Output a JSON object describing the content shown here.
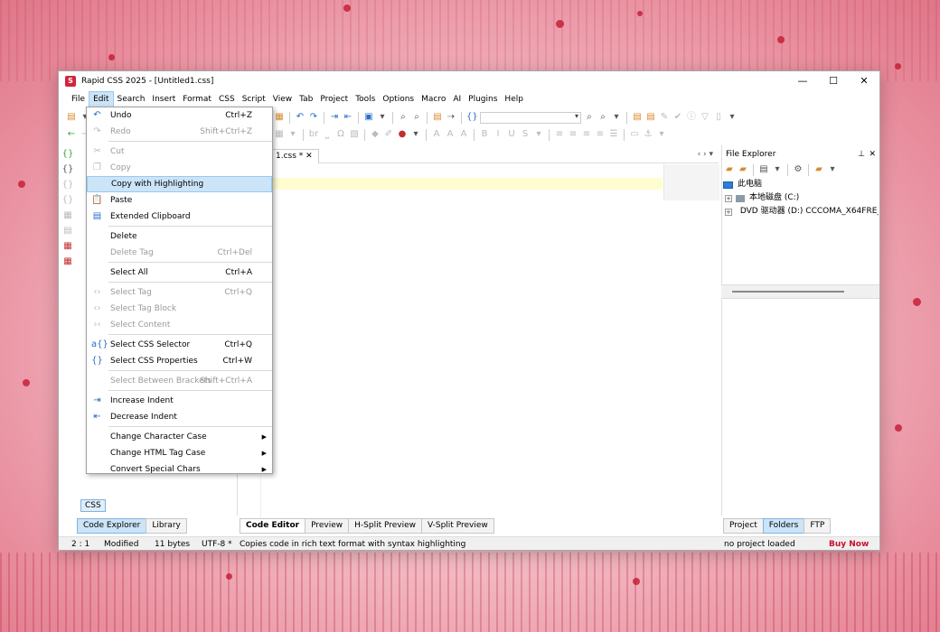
{
  "window": {
    "title": "Rapid CSS 2025 - [Untitled1.css]",
    "minimize": "—",
    "maximize": "☐",
    "close": "✕"
  },
  "menubar": [
    "File",
    "Edit",
    "Search",
    "Insert",
    "Format",
    "CSS",
    "Script",
    "View",
    "Tab",
    "Project",
    "Tools",
    "Options",
    "Macro",
    "AI",
    "Plugins",
    "Help"
  ],
  "menubar_active": "Edit",
  "document_tab": {
    "label": "1.css *",
    "close": "✕"
  },
  "tab_nav": "‹ › ▾",
  "edit_menu": [
    {
      "label": "Undo",
      "shortcut": "Ctrl+Z",
      "icon": "undo-icon",
      "glyph": "↶",
      "enabled": true
    },
    {
      "label": "Redo",
      "shortcut": "Shift+Ctrl+Z",
      "icon": "redo-icon",
      "glyph": "↷",
      "enabled": false
    },
    {
      "sep": true
    },
    {
      "label": "Cut",
      "shortcut": "",
      "icon": "scissors-icon",
      "glyph": "✂",
      "enabled": false
    },
    {
      "label": "Copy",
      "shortcut": "",
      "icon": "copy-icon",
      "glyph": "❐",
      "enabled": false
    },
    {
      "label": "Copy with Highlighting",
      "shortcut": "",
      "icon": "",
      "glyph": "",
      "enabled": true,
      "hover": true
    },
    {
      "label": "Paste",
      "shortcut": "",
      "icon": "paste-icon",
      "glyph": "📋",
      "enabled": true
    },
    {
      "label": "Extended Clipboard",
      "shortcut": "",
      "icon": "clipboard-icon",
      "glyph": "▤",
      "enabled": true
    },
    {
      "sep": true
    },
    {
      "label": "Delete",
      "shortcut": "",
      "icon": "",
      "glyph": "",
      "enabled": true
    },
    {
      "label": "Delete Tag",
      "shortcut": "Ctrl+Del",
      "icon": "",
      "glyph": "",
      "enabled": false
    },
    {
      "sep": true
    },
    {
      "label": "Select All",
      "shortcut": "Ctrl+A",
      "icon": "",
      "glyph": "",
      "enabled": true
    },
    {
      "sep": true
    },
    {
      "label": "Select Tag",
      "shortcut": "Ctrl+Q",
      "icon": "select-tag-icon",
      "glyph": "‹›",
      "enabled": false
    },
    {
      "label": "Select Tag Block",
      "shortcut": "",
      "icon": "select-tag-block-icon",
      "glyph": "‹›",
      "enabled": false
    },
    {
      "label": "Select Content",
      "shortcut": "",
      "icon": "select-content-icon",
      "glyph": "›‹",
      "enabled": false
    },
    {
      "sep": true
    },
    {
      "label": "Select CSS Selector",
      "shortcut": "Ctrl+Q",
      "icon": "css-selector-icon",
      "glyph": "a{}",
      "enabled": true
    },
    {
      "label": "Select CSS Properties",
      "shortcut": "Ctrl+W",
      "icon": "css-properties-icon",
      "glyph": "{}",
      "enabled": true
    },
    {
      "sep": true
    },
    {
      "label": "Select Between Brackets",
      "shortcut": "Shift+Ctrl+A",
      "icon": "",
      "glyph": "",
      "enabled": false
    },
    {
      "sep": true
    },
    {
      "label": "Increase Indent",
      "shortcut": "",
      "icon": "indent-icon",
      "glyph": "⇥",
      "enabled": true
    },
    {
      "label": "Decrease Indent",
      "shortcut": "",
      "icon": "outdent-icon",
      "glyph": "⇤",
      "enabled": true
    },
    {
      "sep": true
    },
    {
      "label": "Change Character Case",
      "shortcut": "",
      "icon": "",
      "glyph": "",
      "enabled": true,
      "submenu": true
    },
    {
      "label": "Change HTML Tag Case",
      "shortcut": "",
      "icon": "",
      "glyph": "",
      "enabled": true,
      "submenu": true
    },
    {
      "label": "Convert Special Chars",
      "shortcut": "",
      "icon": "",
      "glyph": "",
      "enabled": true,
      "submenu": true
    }
  ],
  "file_explorer": {
    "title": "File Explorer",
    "pin": "📌",
    "close": "✕",
    "tree": [
      {
        "label": "此电脑",
        "type": "pc"
      },
      {
        "label": "本地磁盘 (C:)",
        "type": "drive"
      },
      {
        "label": "DVD 驱动器 (D:) CCCOMA_X64FRE_",
        "type": "dvd"
      }
    ]
  },
  "left_bottom_tabs": [
    "Code Explorer",
    "Library"
  ],
  "left_css_badge": "CSS",
  "editor_tabs": [
    "Code Editor",
    "Preview",
    "H-Split Preview",
    "V-Split Preview"
  ],
  "explorer_tabs": [
    "Project",
    "Folders",
    "FTP"
  ],
  "status": {
    "position": "2 : 1",
    "state": "Modified",
    "size": "11 bytes",
    "encoding": "UTF-8 *",
    "hint": "Copies code in rich text format with syntax highlighting",
    "project": "no project loaded",
    "buy": "Buy Now"
  },
  "colors": {
    "accent": "#cce4f7",
    "brand": "#d0263c",
    "buy": "#c8102e"
  }
}
